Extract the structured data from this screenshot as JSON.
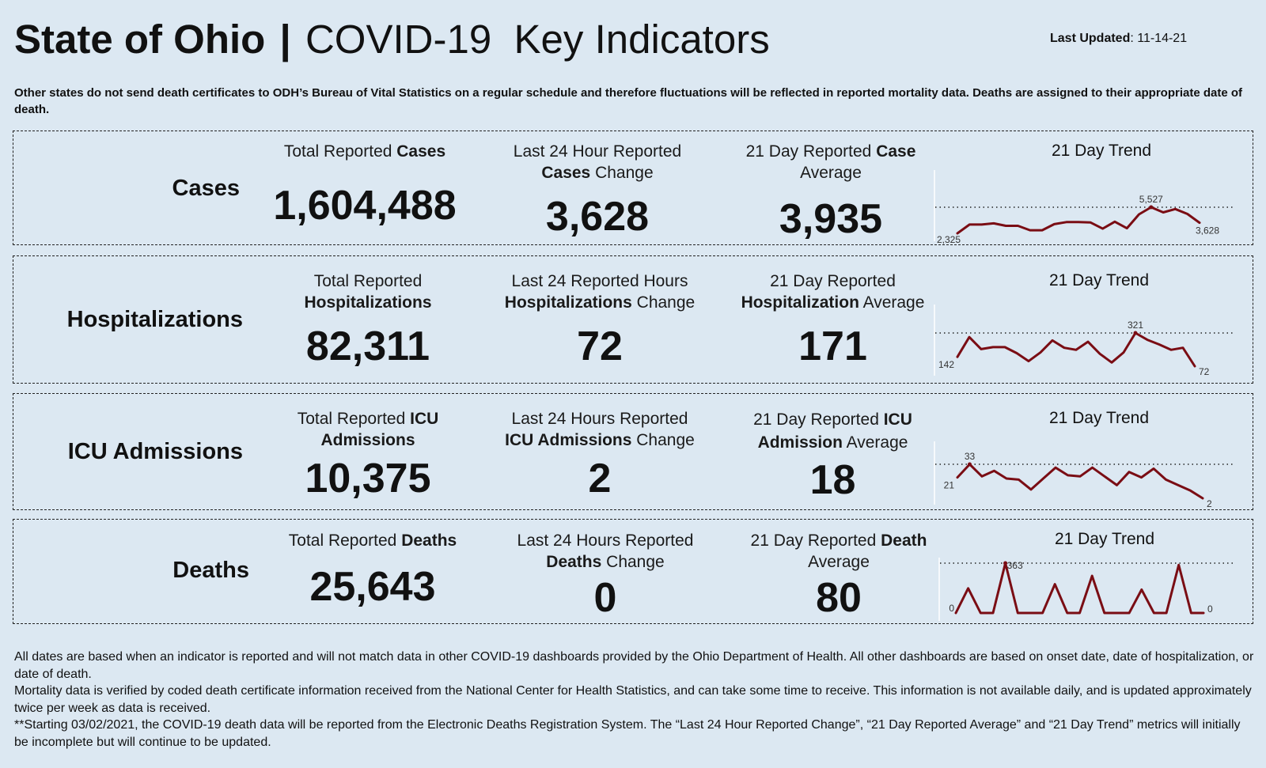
{
  "header": {
    "title_bold": "State of Ohio",
    "title_sep": "|",
    "title_rest": "COVID-19  Key Indicators",
    "last_updated_label": "Last Updated",
    "last_updated_value": ": 11-14-21"
  },
  "notice": "Other states do not send death certificates to ODH’s Bureau of Vital Statistics on a regular schedule and therefore fluctuations will be reflected in reported mortality data. Deaths are assigned to their appropriate date of death.",
  "rows": [
    {
      "label": "Cases",
      "total_head": [
        "Total Reported ",
        "Cases",
        ""
      ],
      "total_value": "1,604,488",
      "change_head": [
        "Last 24 Hour Reported",
        "Cases",
        " Change"
      ],
      "change_value": "3,628",
      "avg_head": [
        "21 Day Reported ",
        "Case",
        "Average"
      ],
      "avg_value": "3,935",
      "trend_title": "21 Day Trend",
      "trend_start_label": "2,325",
      "trend_peak_label": "5,527",
      "trend_end_label": "3,628"
    },
    {
      "label": "Hospitalizations",
      "total_head": [
        "Total Reported",
        "Hospitalizations",
        ""
      ],
      "total_value": "82,311",
      "change_head": [
        "Last 24 Reported Hours",
        "Hospitalizations",
        " Change"
      ],
      "change_value": "72",
      "avg_head": [
        "21 Day Reported",
        "Hospitalization",
        " Average"
      ],
      "avg_value": "171",
      "trend_title": "21 Day Trend",
      "trend_start_label": "142",
      "trend_peak_label": "321",
      "trend_end_label": "72"
    },
    {
      "label": "ICU Admissions",
      "total_head": [
        "Total Reported ",
        "ICU",
        "Admissions"
      ],
      "total_value": "10,375",
      "change_head": [
        "Last 24 Hours Reported",
        "ICU Admissions",
        " Change"
      ],
      "change_value": "2",
      "avg_head": [
        "21 Day Reported ",
        "ICU",
        "Admission",
        " Average"
      ],
      "avg_value": "18",
      "trend_title": "21 Day Trend",
      "trend_start_label": "21",
      "trend_peak_label": "33",
      "trend_end_label": "2"
    },
    {
      "label": "Deaths",
      "total_head": [
        "Total Reported ",
        "Deaths",
        ""
      ],
      "total_value": "25,643",
      "change_head": [
        "Last 24 Hours Reported",
        "Deaths",
        " Change"
      ],
      "change_value": "0",
      "avg_head": [
        "21 Day Reported ",
        "Death",
        "Average"
      ],
      "avg_value": "80",
      "trend_title": "21 Day Trend",
      "trend_start_label": "0",
      "trend_peak_label": "363",
      "trend_end_label": "0"
    }
  ],
  "footer": [
    "All dates are based when an indicator is reported and will not match data in other COVID-19 dashboards provided by the Ohio Department of Health. All other dashboards are based on onset date, date of hospitalization, or date of death.",
    "Mortality data is verified by coded death certificate information received from the National Center for Health Statistics, and can take some time to receive. This information is not available daily, and is updated approximately twice per week as data is received.",
    "**Starting 03/02/2021, the COVID-19 death data will be reported from the Electronic Deaths Registration System. The “Last 24 Hour Reported Change”, “21 Day Reported Average” and “21 Day Trend” metrics will initially be incomplete but will continue to be updated."
  ],
  "colors": {
    "background": "#dce8f2",
    "trend_line": "#7a0d14",
    "text": "#111111"
  },
  "chart_data": [
    {
      "type": "line",
      "title": "21 Day Trend - Cases",
      "x": [
        1,
        2,
        3,
        4,
        5,
        6,
        7,
        8,
        9,
        10,
        11,
        12,
        13,
        14,
        15,
        16,
        17,
        18,
        19,
        20,
        21
      ],
      "values": [
        2325,
        3400,
        3400,
        3550,
        3250,
        3250,
        2700,
        2700,
        3450,
        3700,
        3700,
        3650,
        2900,
        3750,
        2950,
        4650,
        5527,
        4900,
        5300,
        4700,
        3628
      ],
      "reference_line": 5527,
      "labels": {
        "start": "2,325",
        "max": "5,527",
        "end": "3,628"
      },
      "ylim": [
        2000,
        6000
      ]
    },
    {
      "type": "line",
      "title": "21 Day Trend - Hospitalizations",
      "x": [
        1,
        2,
        3,
        4,
        5,
        6,
        7,
        8,
        9,
        10,
        11,
        12,
        13,
        14,
        15,
        16,
        17,
        18,
        19,
        20,
        21
      ],
      "values": [
        142,
        290,
        200,
        215,
        215,
        170,
        110,
        175,
        265,
        210,
        195,
        255,
        165,
        100,
        175,
        321,
        270,
        235,
        195,
        210,
        72
      ],
      "reference_line": 321,
      "labels": {
        "start": "142",
        "max": "321",
        "end": "72"
      },
      "ylim": [
        50,
        350
      ]
    },
    {
      "type": "line",
      "title": "21 Day Trend - ICU Admissions",
      "x": [
        1,
        2,
        3,
        4,
        5,
        6,
        7,
        8,
        9,
        10,
        11,
        12,
        13,
        14,
        15,
        16,
        17,
        18,
        19,
        20,
        21
      ],
      "values": [
        21,
        33,
        22,
        27,
        20,
        19,
        10,
        20,
        30,
        23,
        22,
        30,
        22,
        14,
        26,
        21,
        29,
        19,
        14,
        9,
        2
      ],
      "reference_line": 33,
      "labels": {
        "start": "21",
        "max": "33",
        "end": "2"
      },
      "ylim": [
        0,
        36
      ]
    },
    {
      "type": "line",
      "title": "21 Day Trend - Deaths",
      "x": [
        1,
        2,
        3,
        4,
        5,
        6,
        7,
        8,
        9,
        10,
        11,
        12,
        13,
        14,
        15,
        16,
        17,
        18,
        19,
        20,
        21
      ],
      "values": [
        0,
        180,
        0,
        0,
        363,
        0,
        0,
        0,
        210,
        0,
        0,
        270,
        0,
        0,
        0,
        170,
        0,
        0,
        350,
        0,
        0
      ],
      "reference_line": 363,
      "labels": {
        "start": "0",
        "max": "363",
        "end": "0"
      },
      "ylim": [
        0,
        380
      ]
    }
  ]
}
